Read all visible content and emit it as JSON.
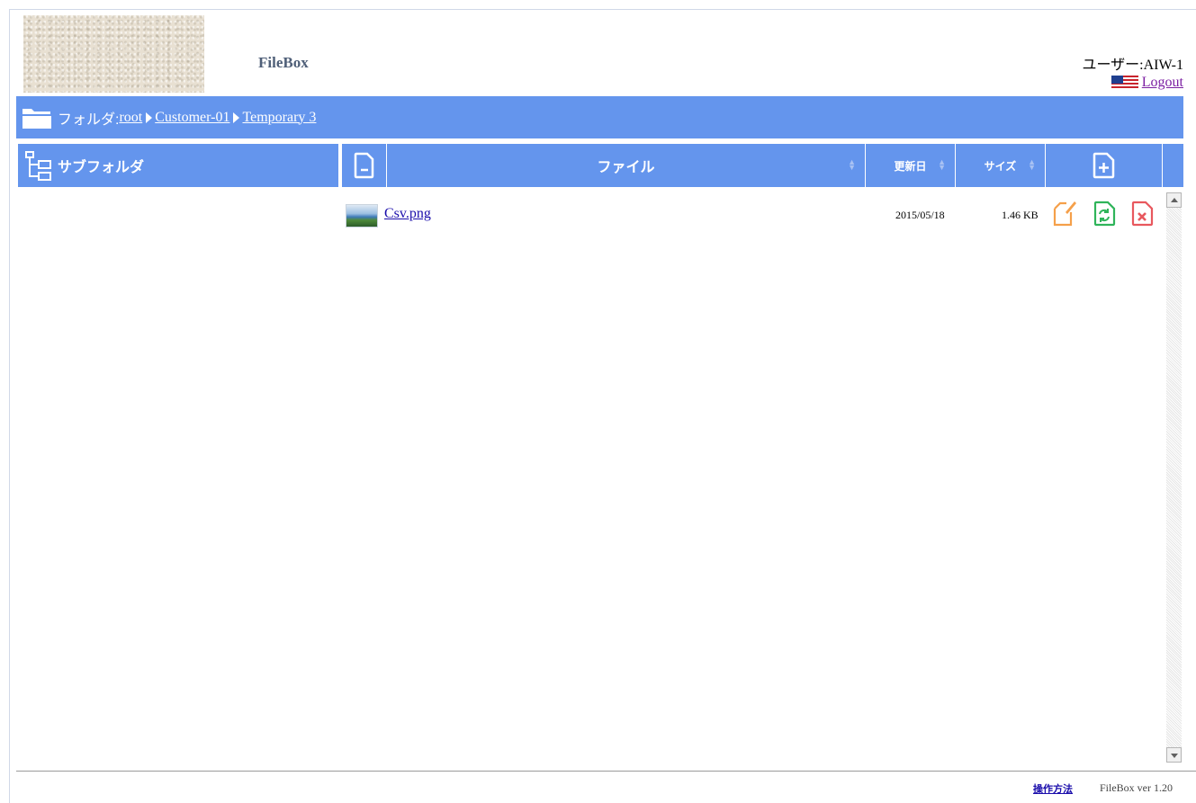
{
  "header": {
    "app_title": "FileBox",
    "user_label": "ユーザー:AIW-1",
    "logout_label": "Logout"
  },
  "breadcrumb": {
    "label": "フォルダ:",
    "items": [
      "root",
      "Customer-01",
      "Temporary 3"
    ]
  },
  "subfolder_panel": {
    "title": "サブフォルダ"
  },
  "file_table": {
    "columns": {
      "name": "ファイル",
      "date": "更新日",
      "size": "サイズ"
    },
    "rows": [
      {
        "name": "Csv.png",
        "date": "2015/05/18",
        "size": "1.46 KB"
      }
    ]
  },
  "footer": {
    "help_link": "操作方法",
    "version": "FileBox ver 1.20"
  },
  "colors": {
    "header_blue": "#6495ed",
    "edit_icon": "#f5a04a",
    "replace_icon": "#2fb45a",
    "delete_icon": "#e8585e"
  }
}
